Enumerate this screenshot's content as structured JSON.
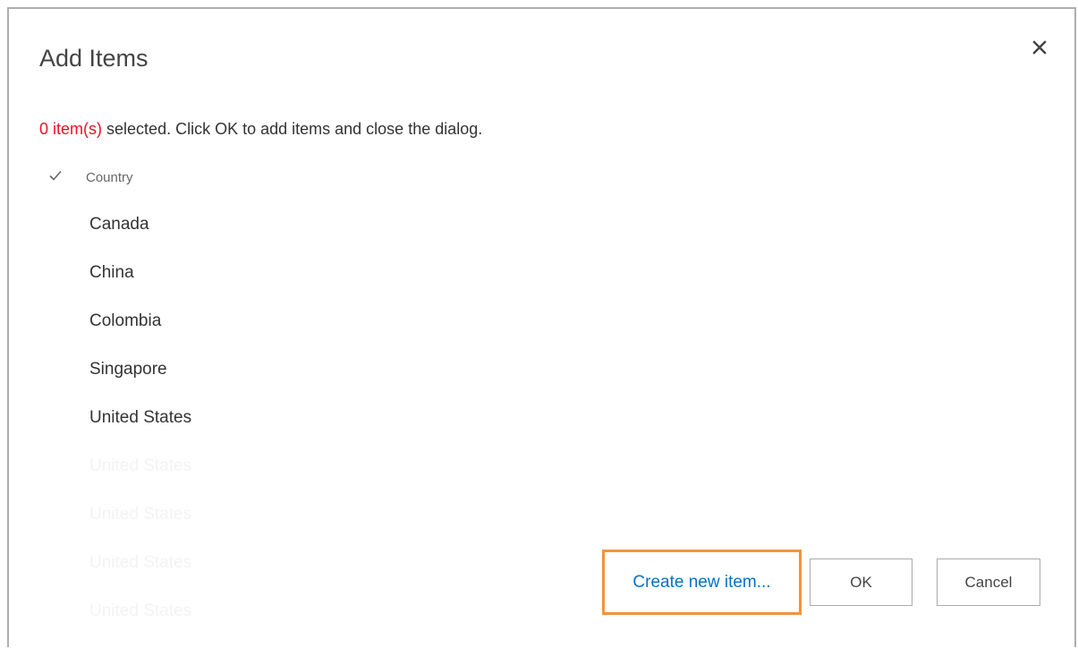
{
  "dialog": {
    "title": "Add Items",
    "close_icon": "close-icon"
  },
  "status": {
    "count_text": "0 item(s)",
    "message": "selected. Click OK to add items and close the dialog."
  },
  "list": {
    "header_icon": "checkmark-icon",
    "column_header": "Country",
    "items": [
      "Canada",
      "China",
      "Colombia",
      "Singapore",
      "United States"
    ],
    "faded_items": [
      "United States",
      "United States",
      "United States",
      "United States"
    ]
  },
  "buttons": {
    "create_new_label": "Create new item...",
    "ok_label": "OK",
    "cancel_label": "Cancel"
  },
  "colors": {
    "accent_link": "#0072c6",
    "count_red": "#e81123",
    "highlight_border": "#f0943e"
  }
}
